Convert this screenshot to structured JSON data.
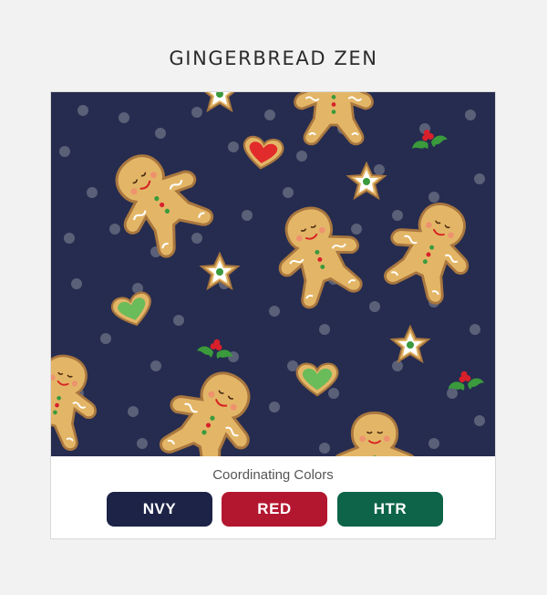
{
  "title": "GINGERBREAD ZEN",
  "coordinating_label": "Coordinating Colors",
  "swatches": [
    {
      "label": "NVY",
      "color": "#1c2347"
    },
    {
      "label": "RED",
      "color": "#b3172f"
    },
    {
      "label": "HTR",
      "color": "#0d6448"
    }
  ],
  "colors": {
    "pattern_background": "#252c4f",
    "polka_dot": "#5a6078",
    "cookie": "#e3b667",
    "cookie_edge": "#a9773f",
    "icing": "#ffffff",
    "holly": "#3a9a3c",
    "berry": "#d8202b"
  },
  "pattern_icons": [
    "gingerbread-man-icon",
    "heart-cookie-icon",
    "star-cookie-icon",
    "holly-icon"
  ]
}
